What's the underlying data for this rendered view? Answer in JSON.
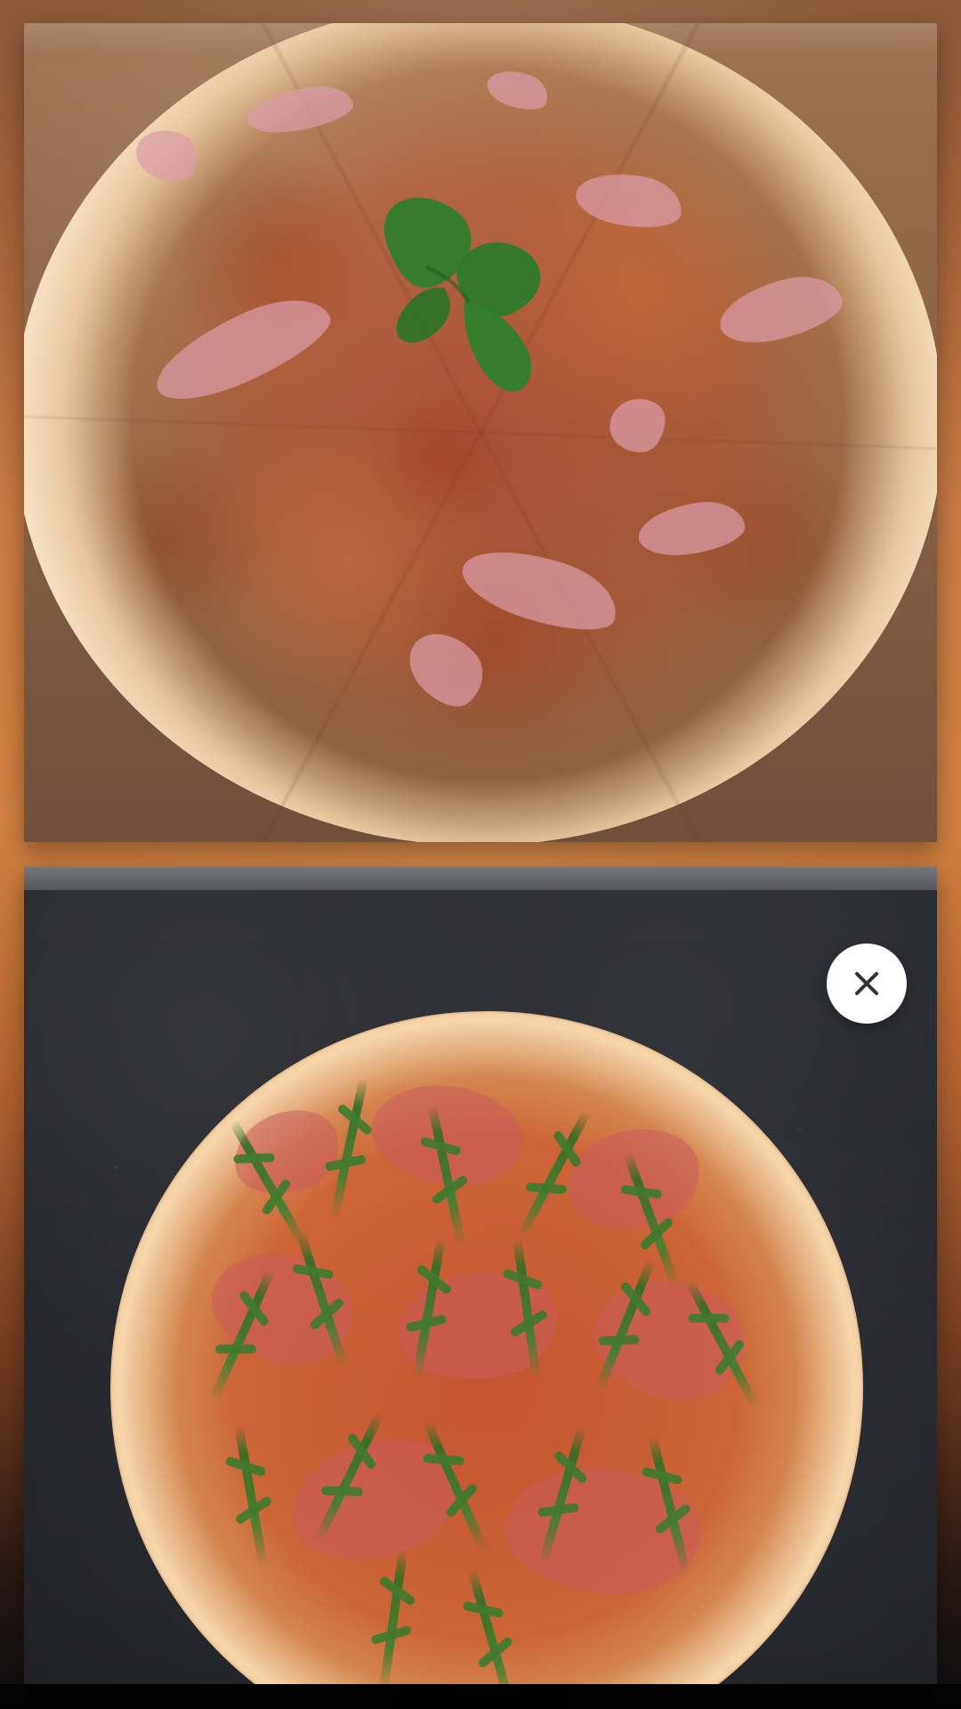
{
  "screen": {
    "background_accent": "#c97a42"
  },
  "top_image": {
    "icon": "pizza-photo-icon"
  },
  "bottom_image": {
    "close_button": {
      "icon": "close-icon",
      "color": "#ffffff",
      "glyph_color": "#333333"
    }
  }
}
